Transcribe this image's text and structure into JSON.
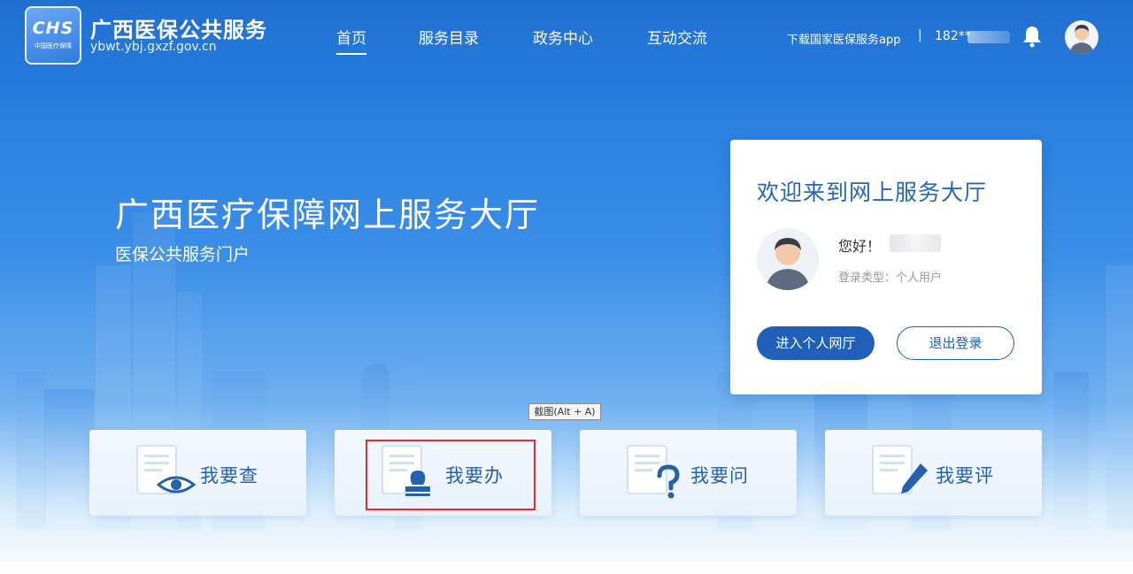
{
  "header": {
    "logo_text": "CHS",
    "logo_sub": "中国医疗保障",
    "brand_title": "广西医保公共服务",
    "brand_url": "ybwt.ybj.gxzf.gov.cn",
    "nav": [
      {
        "label": "首页",
        "active": true
      },
      {
        "label": "服务目录",
        "active": false
      },
      {
        "label": "政务中心",
        "active": false
      },
      {
        "label": "互动交流",
        "active": false
      }
    ],
    "download_app": "下载国家医保服务app",
    "separator": "|",
    "phone_prefix": "182**",
    "bell_icon": "bell-icon",
    "avatar_icon": "user-avatar-icon"
  },
  "hero": {
    "title": "广西医疗保障网上服务大厅",
    "subtitle": "医保公共服务门户"
  },
  "welcome": {
    "title": "欢迎来到网上服务大厅",
    "greeting": "您好！",
    "login_type": "登录类型：个人用户",
    "enter_button": "进入个人网厅",
    "logout_button": "退出登录"
  },
  "tooltip": {
    "text": "截图(Alt + A)"
  },
  "services": [
    {
      "label": "我要查",
      "icon": "eye-document-icon"
    },
    {
      "label": "我要办",
      "icon": "stamp-document-icon"
    },
    {
      "label": "我要问",
      "icon": "question-document-icon"
    },
    {
      "label": "我要评",
      "icon": "pen-document-icon"
    }
  ],
  "colors": {
    "primary": "#2160b8",
    "hero_top": "#1f6fd1",
    "highlight": "#e22b2b",
    "service_text": "#2560aa"
  }
}
